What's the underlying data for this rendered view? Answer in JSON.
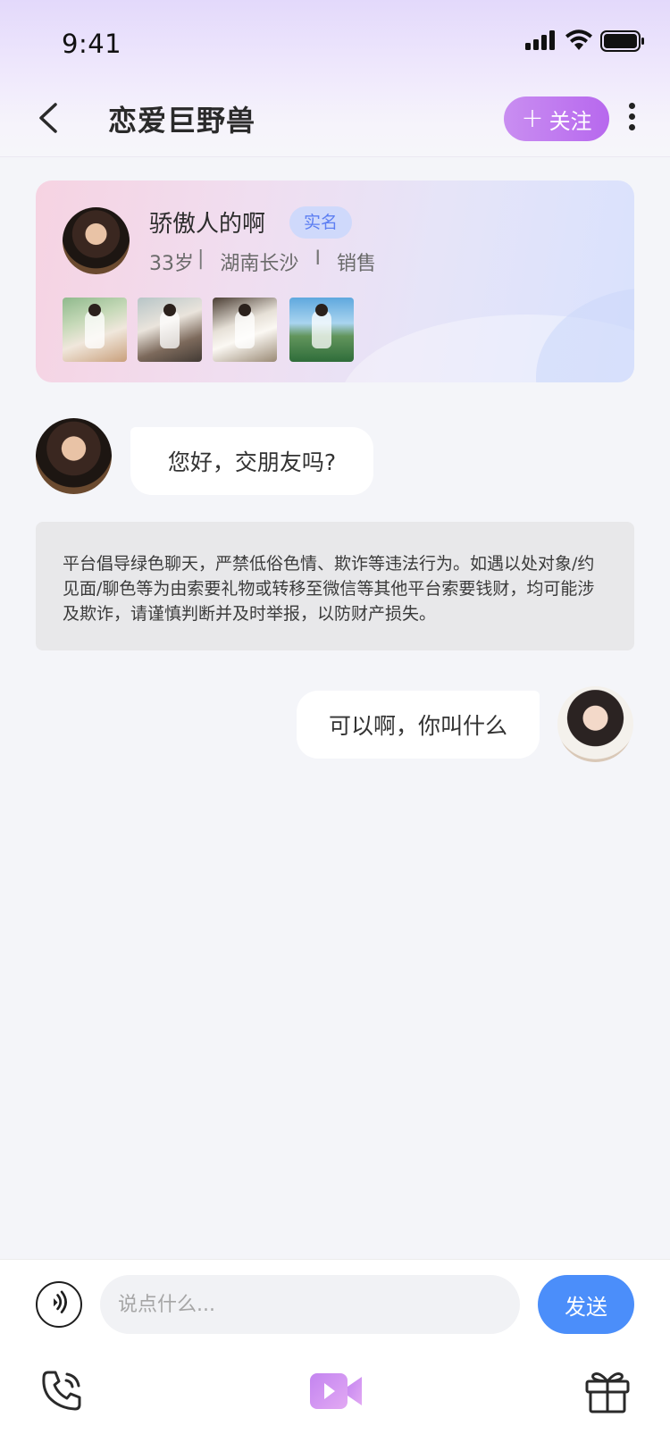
{
  "status_bar": {
    "time": "9:41"
  },
  "nav": {
    "title": "恋爱巨野兽",
    "follow_label": "关注",
    "follow_icon": "+"
  },
  "profile": {
    "name": "骄傲人的啊",
    "verified_badge": "实名",
    "age": "33岁",
    "location": "湖南长沙",
    "occupation": "销售",
    "separator_1": "|",
    "separator_2": "I",
    "photo_count": 4
  },
  "messages": [
    {
      "side": "left",
      "text": "您好，交朋友吗?"
    },
    {
      "side": "right",
      "text": "可以啊，你叫什么"
    }
  ],
  "notice": {
    "text": "平台倡导绿色聊天，严禁低俗色情、欺诈等违法行为。如遇以处对象/约见面/聊色等为由索要礼物或转移至微信等其他平台索要钱财，均可能涉及欺诈，请谨慎判断并及时举报，以防财产损失。"
  },
  "composer": {
    "placeholder": "说点什么...",
    "send_label": "发送"
  },
  "toolbar": {
    "icons": [
      "phone-icon",
      "video-icon",
      "gift-icon"
    ]
  },
  "colors": {
    "accent_purple": "#b768ee",
    "send_blue": "#4b8efa",
    "badge_blue": "#5d7ff2",
    "page_bg": "#f4f5f9"
  }
}
